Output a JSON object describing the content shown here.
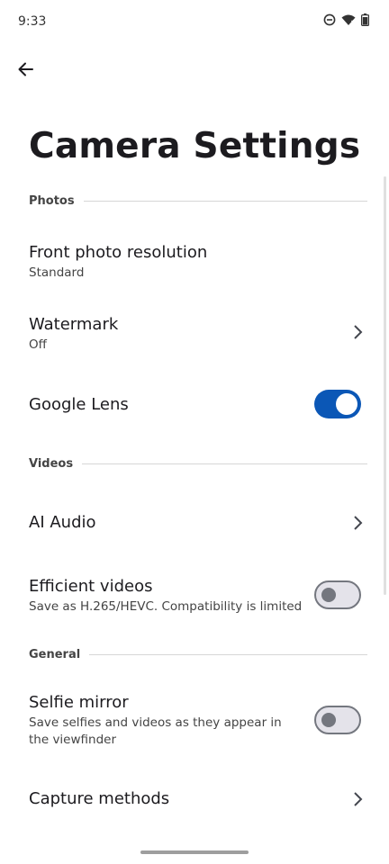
{
  "status": {
    "time": "9:33",
    "icons": [
      "dnd-icon",
      "wifi-icon",
      "battery-icon"
    ]
  },
  "page": {
    "title": "Camera Settings"
  },
  "sections": {
    "photos": {
      "label": "Photos",
      "front_resolution": {
        "title": "Front photo resolution",
        "subtitle": "Standard"
      },
      "watermark": {
        "title": "Watermark",
        "subtitle": "Off"
      },
      "google_lens": {
        "title": "Google Lens",
        "enabled": true
      }
    },
    "videos": {
      "label": "Videos",
      "ai_audio": {
        "title": "AI Audio"
      },
      "efficient_videos": {
        "title": "Efficient videos",
        "subtitle": "Save as H.265/HEVC. Compatibility is limited",
        "enabled": false
      }
    },
    "general": {
      "label": "General",
      "selfie_mirror": {
        "title": "Selfie mirror",
        "subtitle": "Save selfies and videos as they appear in the viewfinder",
        "enabled": false
      },
      "capture_methods": {
        "title": "Capture methods"
      }
    }
  },
  "colors": {
    "accent": "#0b57b6",
    "text": "#1c1b1f",
    "divider": "#d6d6d6"
  }
}
